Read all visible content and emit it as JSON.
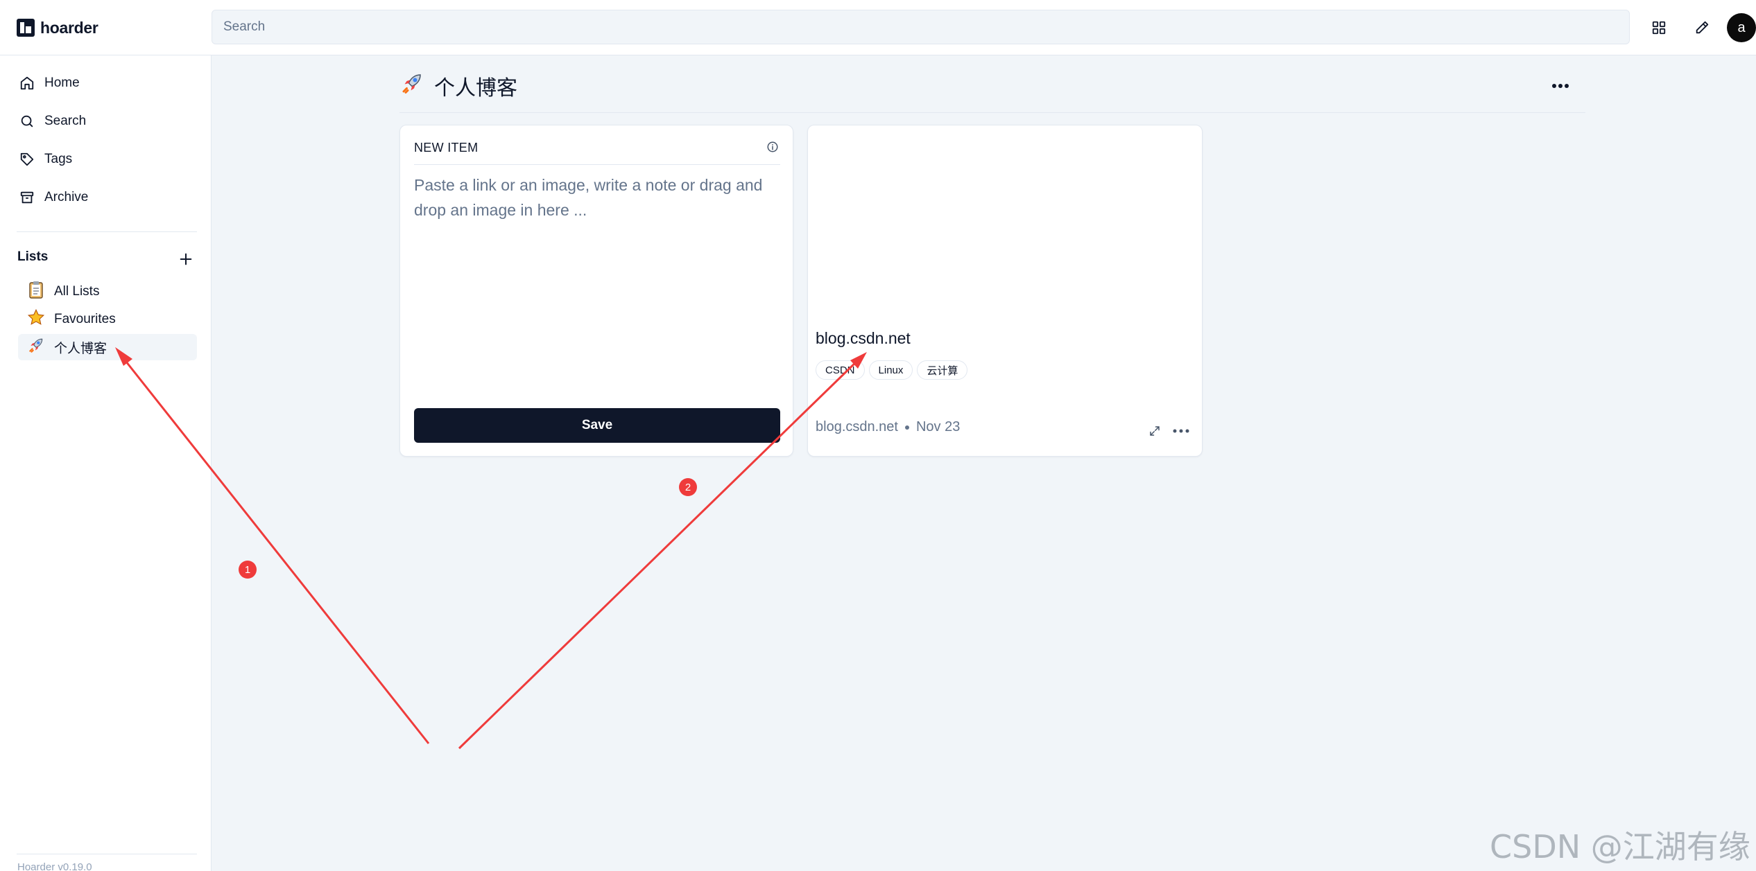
{
  "app": {
    "name": "hoarder",
    "version": "Hoarder v0.19.0"
  },
  "search": {
    "placeholder": "Search"
  },
  "header": {
    "avatar_letter": "a",
    "icons": [
      "grid-view-icon",
      "edit-pencil-icon"
    ]
  },
  "sidebar": {
    "nav": [
      {
        "label": "Home",
        "icon": "home-icon"
      },
      {
        "label": "Search",
        "icon": "search-icon"
      },
      {
        "label": "Tags",
        "icon": "tag-icon"
      },
      {
        "label": "Archive",
        "icon": "archive-icon"
      }
    ],
    "lists_title": "Lists",
    "lists": [
      {
        "label": "All Lists",
        "icon": "clipboard-emoji"
      },
      {
        "label": "Favourites",
        "icon": "star-emoji"
      },
      {
        "label": "个人博客",
        "icon": "rocket-emoji",
        "active": true
      }
    ]
  },
  "page": {
    "emoji": "🚀",
    "title": "个人博客"
  },
  "new_item": {
    "title": "NEW ITEM",
    "placeholder": "Paste a link or an image, write a note or drag and drop an image in here ...",
    "save_label": "Save"
  },
  "bookmark": {
    "title": "blog.csdn.net",
    "tags": [
      "CSDN",
      "Linux",
      "云计算"
    ],
    "source": "blog.csdn.net",
    "date": "Nov 23"
  },
  "annotations": {
    "marker_1": "1",
    "marker_2": "2",
    "arrow_color": "#ef3b3b"
  },
  "watermark": "CSDN @江湖有缘"
}
